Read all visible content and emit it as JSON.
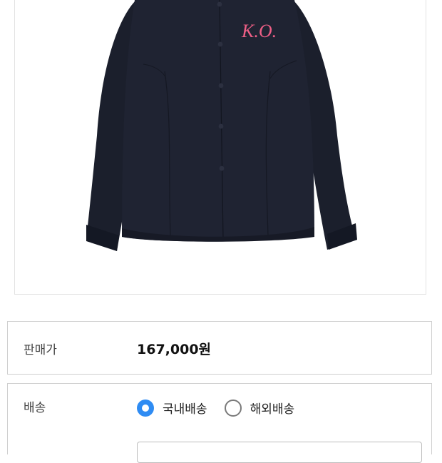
{
  "product": {
    "image_alt": "Dark navy shirt",
    "logo_text": "K.O.",
    "colors": {
      "shirt": "#1e2230",
      "shirt_shade": "#121520",
      "logo": "#ee5f86",
      "accent": "#2f8cf3"
    }
  },
  "price_row": {
    "label": "판매가",
    "value": "167,000원"
  },
  "shipping_row": {
    "label": "배송",
    "options": [
      {
        "label": "국내배송",
        "selected": true
      },
      {
        "label": "해외배송",
        "selected": false
      }
    ]
  }
}
